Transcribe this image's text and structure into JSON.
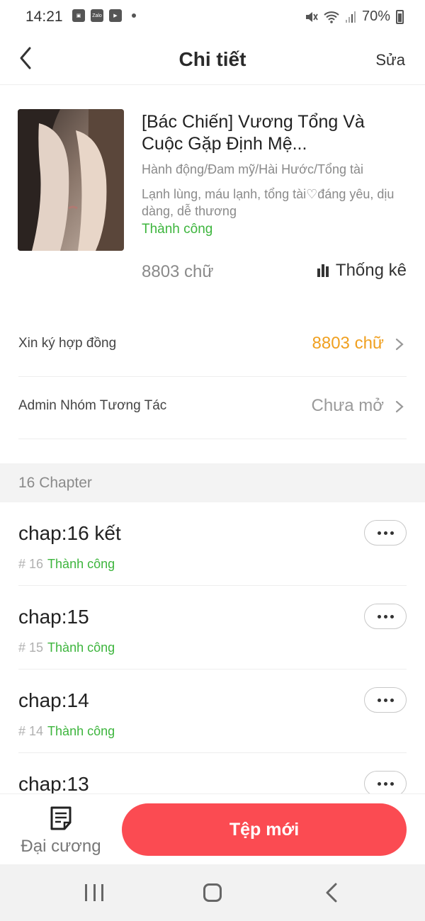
{
  "status_bar": {
    "time": "14:21",
    "left_icons": [
      "gallery-icon",
      "zalo-icon",
      "youtube-icon",
      "dot-icon"
    ],
    "zalo_label": "Zalo",
    "battery": "70%"
  },
  "header": {
    "title": "Chi tiết",
    "edit_label": "Sửa"
  },
  "book": {
    "title": "[Bác Chiến] Vương Tổng Và Cuộc Gặp Định Mệ...",
    "genres": "Hành động/Đam mỹ/Hài Hước/Tổng tài",
    "tags": "Lạnh lùng, máu lạnh, tổng tài♡đáng yêu, dịu dàng, dễ thương",
    "status": "Thành công",
    "word_count": "8803 chữ",
    "stats_label": "Thống kê"
  },
  "rows": [
    {
      "label": "Xin ký hợp đồng",
      "value": "8803 chữ",
      "value_color": "#f0a020"
    },
    {
      "label": "Admin Nhóm Tương Tác",
      "value": "Chưa mở",
      "value_color": "#9a9a9a"
    }
  ],
  "chapters_section": {
    "title": "16 Chapter",
    "items": [
      {
        "title": "chap:16 kết",
        "number": "# 16",
        "status": "Thành công"
      },
      {
        "title": "chap:15",
        "number": "# 15",
        "status": "Thành công"
      },
      {
        "title": "chap:14",
        "number": "# 14",
        "status": "Thành công"
      },
      {
        "title": "chap:13"
      }
    ]
  },
  "actions": {
    "outline_label": "Đại cương",
    "new_file_label": "Tệp mới"
  },
  "colors": {
    "accent_red": "#fb4b52",
    "success_green": "#3db53d",
    "warning_orange": "#f0a020"
  }
}
